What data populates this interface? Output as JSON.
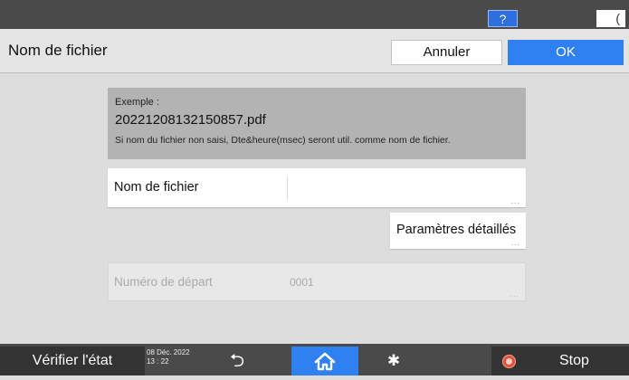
{
  "topbar": {
    "help_label": "?",
    "sleep_icon": "moon-icon",
    "sleep_glyph": "("
  },
  "header": {
    "title": "Nom de fichier",
    "cancel_label": "Annuler",
    "ok_label": "OK"
  },
  "example": {
    "label": "Exemple :",
    "filename": "20221208132150857.pdf",
    "note": "Si nom du fichier non saisi, Dte&heure(msec) seront util. comme nom de fichier."
  },
  "filename_field": {
    "label": "Nom de fichier",
    "value": "",
    "more": "..."
  },
  "details_button": {
    "label": "Paramètres détaillés",
    "more": "..."
  },
  "start_number": {
    "label": "Numéro de départ",
    "value": "0001",
    "more": "..."
  },
  "bottombar": {
    "status_label": "Vérifier l'état",
    "date": "08 Déc. 2022",
    "time": "13 : 22",
    "back_icon": "back-arrow-icon",
    "back_glyph": "⮌",
    "home_icon": "home-icon",
    "settings_icon": "gear-icon",
    "settings_glyph": "✱",
    "stop_icon": "stop-icon",
    "stop_label": "Stop"
  },
  "colors": {
    "accent": "#2f80f0",
    "bar": "#4a4a4a",
    "stop": "#e0533b"
  }
}
